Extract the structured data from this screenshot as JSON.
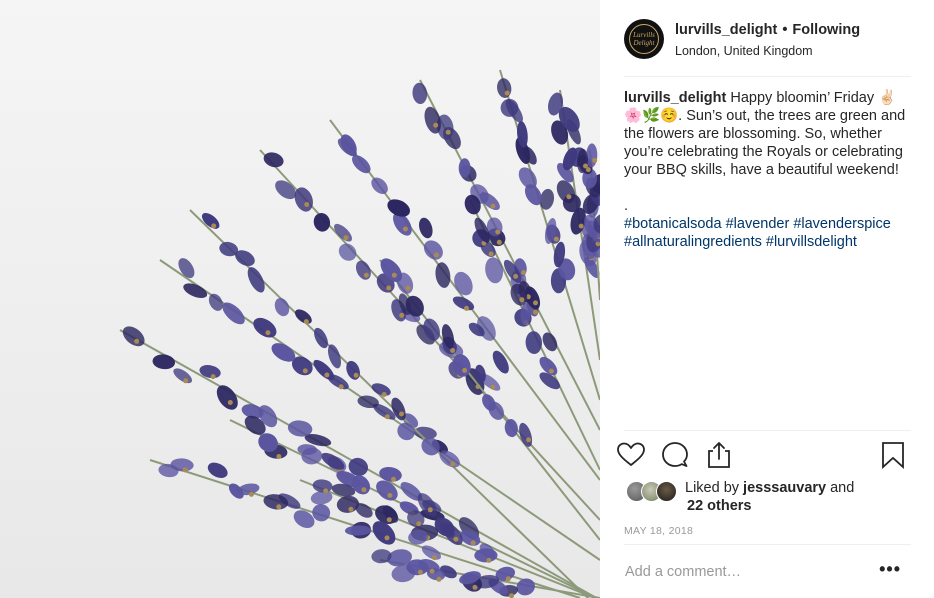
{
  "post": {
    "username": "lurvills_delight",
    "separator": "•",
    "follow_status": "Following",
    "location": "London, United Kingdom",
    "avatar_text": "Lurvills Delight",
    "caption": {
      "author": "lurvills_delight",
      "text": " Happy bloomin’ Friday ✌🏻 🌸🌿☺️. Sun’s out, the trees are green and the flowers are blossoming. So, whether you’re celebrating the Royals or celebrating your BBQ skills, have a beautiful weekend!",
      "dot": ".",
      "hashtags": [
        "#botanicalsoda",
        "#lavender",
        "#lavenderspice",
        "#allnaturalingredients",
        "#lurvillsdelight"
      ]
    },
    "likes": {
      "prefix": "Liked by ",
      "user": "jesssauvary",
      "suffix": " and",
      "others": "22 others"
    },
    "date": "MAY 18, 2018",
    "comment_placeholder": "Add a comment…",
    "more_label": "•••"
  },
  "icons": {
    "like": "heart-icon",
    "comment": "comment-icon",
    "share": "share-icon",
    "save": "bookmark-icon"
  },
  "colors": {
    "hashtag": "#003569",
    "lavender": "#3f3a7e",
    "stem": "#8d9a7a"
  }
}
